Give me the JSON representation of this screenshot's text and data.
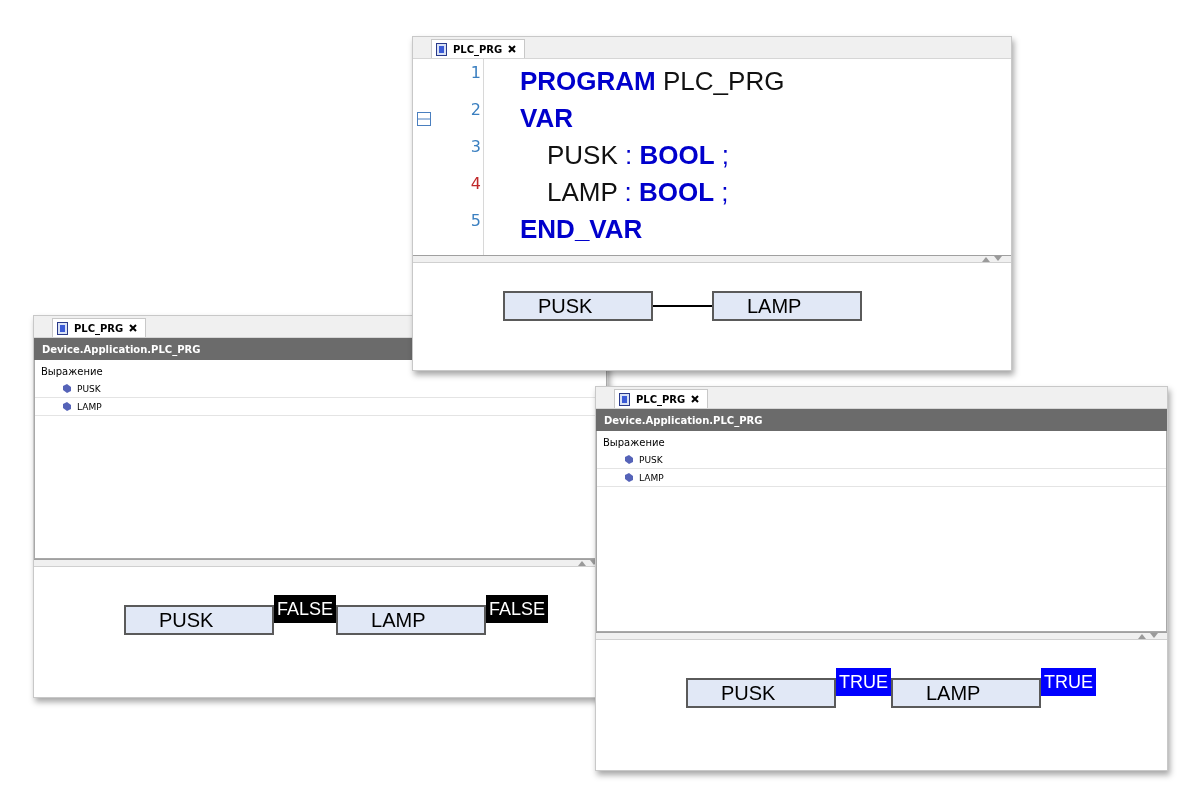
{
  "windows": [
    {
      "kind": "watch",
      "tab": "PLC_PRG",
      "path": "Device.Application.PLC_PRG",
      "column": "Выражение",
      "variables": [
        "PUSK",
        "LAMP"
      ],
      "diagram": {
        "connected": false,
        "blocks": [
          {
            "name": "PUSK",
            "value": "FALSE",
            "on": false
          },
          {
            "name": "LAMP",
            "value": "FALSE",
            "on": false
          }
        ]
      }
    },
    {
      "kind": "editor",
      "tab": "PLC_PRG",
      "lines": [
        {
          "number": "1",
          "marked": false,
          "fold": false,
          "indented": false,
          "tokens": [
            {
              "text": "PROGRAM",
              "kind": "keyword"
            },
            {
              "text": "PLC_PRG",
              "kind": "ident"
            }
          ]
        },
        {
          "number": "2",
          "marked": false,
          "fold": true,
          "indented": false,
          "tokens": [
            {
              "text": "VAR",
              "kind": "keyword"
            }
          ]
        },
        {
          "number": "3",
          "marked": false,
          "fold": false,
          "indented": true,
          "tokens": [
            {
              "text": "PUSK",
              "kind": "ident"
            },
            {
              "text": ":",
              "kind": "punct"
            },
            {
              "text": "BOOL",
              "kind": "keyword"
            },
            {
              "text": ";",
              "kind": "punct"
            }
          ]
        },
        {
          "number": "4",
          "marked": true,
          "fold": false,
          "indented": true,
          "tokens": [
            {
              "text": "LAMP",
              "kind": "ident"
            },
            {
              "text": ":",
              "kind": "punct"
            },
            {
              "text": "BOOL",
              "kind": "keyword"
            },
            {
              "text": ";",
              "kind": "punct"
            }
          ]
        },
        {
          "number": "5",
          "marked": false,
          "fold": false,
          "indented": false,
          "tokens": [
            {
              "text": "END_VAR",
              "kind": "keyword"
            }
          ]
        }
      ],
      "diagram": {
        "connected": true,
        "blocks": [
          {
            "name": "PUSK"
          },
          {
            "name": "LAMP"
          }
        ]
      }
    },
    {
      "kind": "watch",
      "tab": "PLC_PRG",
      "path": "Device.Application.PLC_PRG",
      "column": "Выражение",
      "variables": [
        "PUSK",
        "LAMP"
      ],
      "diagram": {
        "connected": false,
        "blocks": [
          {
            "name": "PUSK",
            "value": "TRUE",
            "on": true
          },
          {
            "name": "LAMP",
            "value": "TRUE",
            "on": true
          }
        ]
      }
    }
  ]
}
